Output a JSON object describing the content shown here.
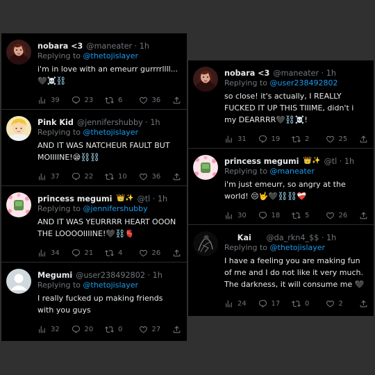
{
  "left_column": {
    "tweets": [
      {
        "name": "nobara <3",
        "handle": "@maneater",
        "time": "1h",
        "reply_prefix": "Replying to",
        "reply_to": "@thetojislayer",
        "text": "i'm in love with an emeurr gurrrrllll...🖤☠️⛓️",
        "stats": {
          "views": "39",
          "replies": "23",
          "retweets": "6",
          "likes": "36"
        }
      },
      {
        "name": "Pink Kid",
        "handle": "@jennifershubby",
        "time": "1h",
        "reply_prefix": "Replying to",
        "reply_to": "@thetojislayer",
        "text": "AND IT WAS NATCHEUR FAULT BUT MOIIIINE!😪⛓️⛓️",
        "stats": {
          "views": "37",
          "replies": "22",
          "retweets": "10",
          "likes": "36"
        }
      },
      {
        "name": "princess megumi",
        "name_emoji": "👑✨",
        "handle": "@tl",
        "time": "1h",
        "reply_prefix": "Replying to",
        "reply_to": "@jennifershubby",
        "text": "AND IT WAS YEURRRR HEART OOON THE LOOOOIIIINE!🖤⛓️🫀",
        "stats": {
          "views": "34",
          "replies": "21",
          "retweets": "4",
          "likes": "26"
        }
      },
      {
        "name": "Megumi",
        "handle": "@user238492802",
        "time": "1h",
        "reply_prefix": "Replying to",
        "reply_to": "@thetojislayer",
        "text": "I really fucked up making friends with you guys",
        "stats": {
          "views": "32",
          "replies": "20",
          "retweets": "0",
          "likes": "27"
        }
      }
    ]
  },
  "right_column": {
    "tweets": [
      {
        "name": "nobara <3",
        "handle": "@maneater",
        "time": "1h",
        "reply_prefix": "Replying to",
        "reply_to": "@user238492802",
        "text": "so close! it's actually, I REALLY FUCKED IT UP THIS TIIIME, didn't i my DEARRRR🖤⛓️☠️!",
        "stats": {
          "views": "31",
          "replies": "19",
          "retweets": "2",
          "likes": "25"
        }
      },
      {
        "name": "princess megumi",
        "name_emoji": "👑✨",
        "handle": "@tl",
        "time": "1h",
        "reply_prefix": "Replying to",
        "reply_to": "@maneater",
        "text": "i'm just emeurr, so angry at the world! 😔🤟🖤⛓️⛓️❤️‍🩹",
        "stats": {
          "views": "30",
          "replies": "18",
          "retweets": "5",
          "likes": "26"
        }
      },
      {
        "name": "Kai",
        "name_prefix": "🕷",
        "name_emoji": "🌑",
        "handle": "@da_rkn4_$$",
        "time": "1h",
        "reply_prefix": "Replying to",
        "reply_to": "@thetojislayer",
        "text": "I have a feeling you are making fun of me and I do not like it very much. The darkness, it will consume me 🖤",
        "stats": {
          "views": "24",
          "replies": "17",
          "retweets": "0",
          "likes": "2"
        }
      }
    ]
  },
  "colors": {
    "background": "#303030",
    "panel": "#000000",
    "text": "#e7e9ea",
    "muted": "#71767b",
    "mention": "#1d9bf0"
  }
}
